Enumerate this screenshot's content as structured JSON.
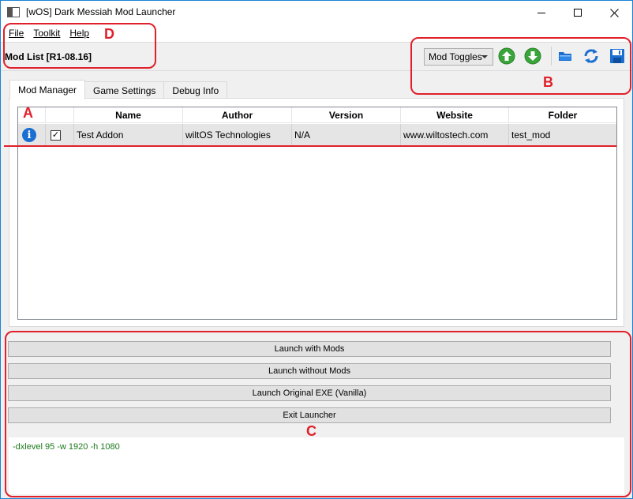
{
  "window": {
    "title": "[wOS] Dark Messiah Mod Launcher"
  },
  "menu": {
    "file": "File",
    "toolkit": "Toolkit",
    "help": "Help"
  },
  "mod_list_title": "Mod List [R1-08.16]",
  "toolbar": {
    "select_value": "Mod Toggles",
    "icons": [
      "move-up-icon",
      "move-down-icon",
      "folder-icon",
      "refresh-icon",
      "save-icon"
    ]
  },
  "tabs": [
    {
      "label": "Mod Manager",
      "active": true
    },
    {
      "label": "Game Settings",
      "active": false
    },
    {
      "label": "Debug Info",
      "active": false
    }
  ],
  "table": {
    "headers": [
      "",
      "",
      "Name",
      "Author",
      "Version",
      "Website",
      "Folder"
    ],
    "rows": [
      {
        "checked": true,
        "name": "Test Addon",
        "author": "wiltOS Technologies",
        "version": "N/A",
        "website": "www.wiltostech.com",
        "folder": "test_mod"
      }
    ]
  },
  "buttons": {
    "launch_mods": "Launch with Mods",
    "launch_no_mods": "Launch without Mods",
    "launch_vanilla": "Launch Original EXE (Vanilla)",
    "exit": "Exit Launcher"
  },
  "command_line": "-dxlevel 95 -w 1920 -h 1080",
  "annotations": {
    "a": "A",
    "b": "B",
    "c": "C",
    "d": "D"
  },
  "colors": {
    "annotation": "#e0202a",
    "command_text": "#1b7a1b",
    "window_border": "#1883d7",
    "info_icon": "#1a6fd1",
    "arrow_green": "#3aa53a"
  }
}
